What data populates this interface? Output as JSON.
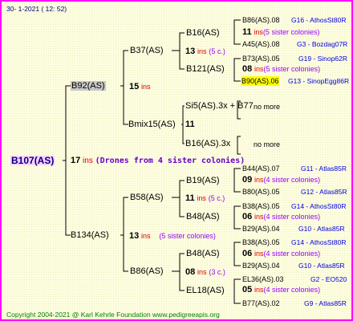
{
  "header": "30-   1-2021  ( 12:  52)",
  "root": {
    "name": "B107(AS)",
    "num": "17",
    "ins": "ins",
    "drones": "(Drones from 4 sister colonies)"
  },
  "gen1": [
    {
      "name": "B92(AS)",
      "num": "15",
      "ins": "ins",
      "sis": ""
    },
    {
      "name": "B134(AS)",
      "num": "13",
      "ins": "ins",
      "sis": "(5 sister colonies)"
    }
  ],
  "gen2": [
    {
      "name": "B37(AS)",
      "num": "13",
      "ins": "ins",
      "sis": "(5 c.)"
    },
    {
      "name": "Bmix15(AS)",
      "num": "11",
      "ins": "",
      "sis": ""
    },
    {
      "name": "B58(AS)",
      "num": "11",
      "ins": "ins",
      "sis": "(5 c.)"
    },
    {
      "name": "B86(AS)",
      "num": "08",
      "ins": "ins",
      "sis": "(3 c.)"
    }
  ],
  "gen3": [
    {
      "name": "B16(AS)",
      "num": "11",
      "ins": "ins",
      "sis": "(5 sister colonies)"
    },
    {
      "name": "B121(AS)",
      "num": "08",
      "ins": "ins",
      "sis": "(5 sister colonies)"
    },
    {
      "name": "Si5(AS).3x + B77",
      "num": "",
      "ins": "",
      "sis": ""
    },
    {
      "name": "B16(AS).3x",
      "num": "",
      "ins": "",
      "sis": ""
    },
    {
      "name": "B19(AS)",
      "num": "09",
      "ins": "ins",
      "sis": "(4 sister colonies)"
    },
    {
      "name": "B48(AS)",
      "num": "06",
      "ins": "ins",
      "sis": "(4 sister colonies)"
    },
    {
      "name": "B48(AS)",
      "num": "06",
      "ins": "ins",
      "sis": "(4 sister colonies)"
    },
    {
      "name": "EL18(AS)",
      "num": "05",
      "ins": "ins",
      "sis": "(4 sister colonies)"
    }
  ],
  "gen4": [
    {
      "left": "B86(AS).08",
      "right": "G16 - AthosSt80R"
    },
    {
      "left": "A45(AS).08",
      "right": "G3 - Bozdag07R"
    },
    {
      "left": "B73(AS).05",
      "right": "G19 - Sinop62R"
    },
    {
      "left": "B90(AS).06",
      "right": "G13 - SinopEgg86R"
    },
    {
      "left": "B44(AS).07",
      "right": "G11 - Atlas85R"
    },
    {
      "left": "B80(AS).05",
      "right": "G12 - Atlas85R"
    },
    {
      "left": "B38(AS).05",
      "right": "G14 - AthosSt80R"
    },
    {
      "left": "B29(AS).04",
      "right": "G10 - Atlas85R"
    },
    {
      "left": "B38(AS).05",
      "right": "G14 - AthosSt80R"
    },
    {
      "left": "B29(AS).04",
      "right": "G10 - Atlas85R"
    },
    {
      "left": "EL36(AS).03",
      "right": "G2 - EO520"
    },
    {
      "left": "B77(AS).02",
      "right": "G9 - Atlas85R"
    }
  ],
  "nomore": [
    "no more",
    "no more"
  ],
  "footer": "Copyright 2004-2021 @ Karl Kehrle Foundation    www.pedigreeapis.org"
}
